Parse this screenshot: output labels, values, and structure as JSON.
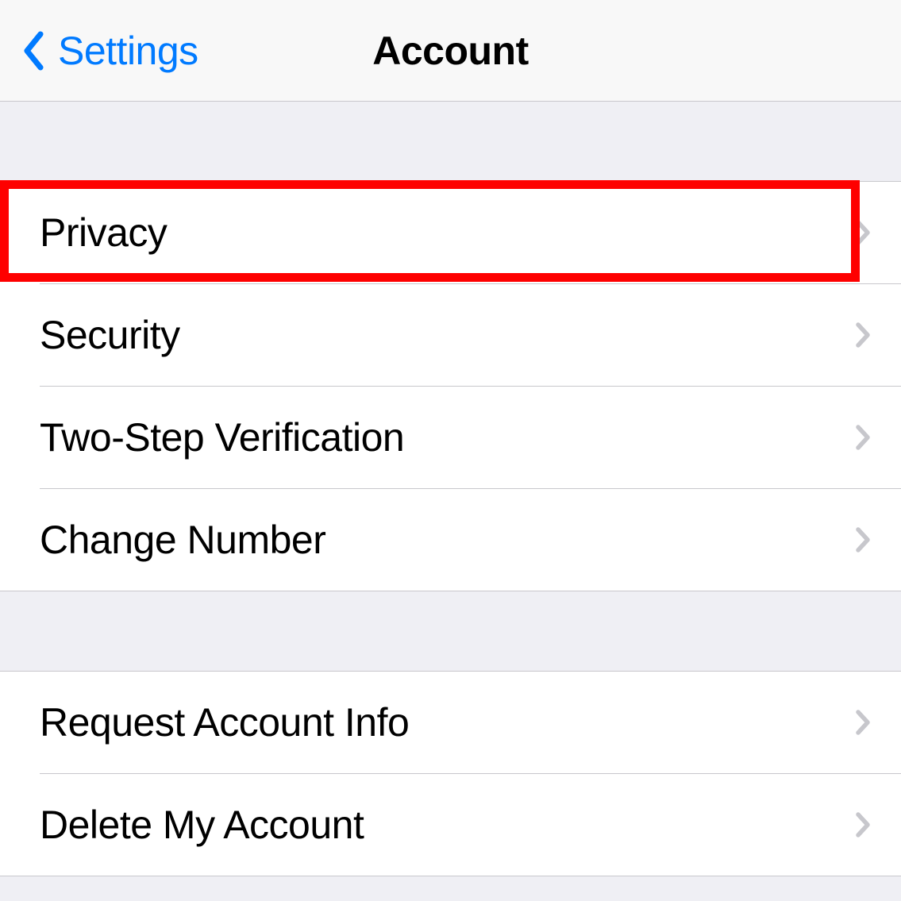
{
  "header": {
    "back_label": "Settings",
    "title": "Account"
  },
  "sections": [
    {
      "rows": [
        {
          "label": "Privacy"
        },
        {
          "label": "Security"
        },
        {
          "label": "Two-Step Verification"
        },
        {
          "label": "Change Number"
        }
      ]
    },
    {
      "rows": [
        {
          "label": "Request Account Info"
        },
        {
          "label": "Delete My Account"
        }
      ]
    }
  ],
  "colors": {
    "accent": "#007aff",
    "highlight": "#fe0000"
  }
}
